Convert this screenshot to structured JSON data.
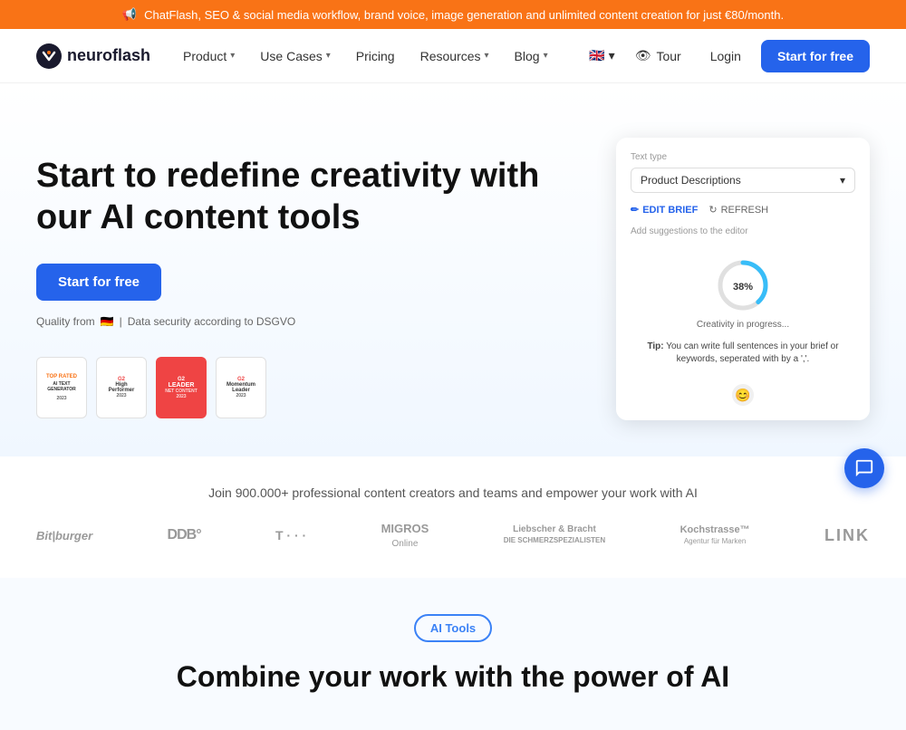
{
  "banner": {
    "icon": "📢",
    "text": "ChatFlash, SEO & social media workflow, brand voice, image generation and unlimited content creation for just €80/month."
  },
  "navbar": {
    "logo_text": "neuroflash",
    "nav_items": [
      {
        "label": "Product",
        "has_dropdown": true
      },
      {
        "label": "Use Cases",
        "has_dropdown": true
      },
      {
        "label": "Pricing",
        "has_dropdown": false
      },
      {
        "label": "Resources",
        "has_dropdown": true
      },
      {
        "label": "Blog",
        "has_dropdown": true
      }
    ],
    "flag": "🇬🇧",
    "tour_label": "Tour",
    "login_label": "Login",
    "start_label": "Start for free"
  },
  "hero": {
    "title": "Start to redefine creativity with our AI content tools",
    "cta_label": "Start for free",
    "quality_text": "Quality from",
    "quality_suffix": "Data security according to DSGVO",
    "flag": "🇩🇪",
    "badges": [
      {
        "line1": "TOP RATED",
        "line2": "AI TEXT\nGENERATOR",
        "year": "2023",
        "type": "capterra"
      },
      {
        "line1": "High\nPerformer",
        "year": "2023",
        "type": "g2-high"
      },
      {
        "line1": "LEADER",
        "line2": "NET\nCONTENT",
        "year": "2023",
        "type": "g2-leader"
      },
      {
        "line1": "Momentum\nLeader",
        "year": "2023",
        "type": "g2-momentum"
      }
    ]
  },
  "ui_preview": {
    "text_type_label": "Text type",
    "text_type_value": "Product Descriptions",
    "edit_brief_label": "EDIT BRIEF",
    "refresh_label": "REFRESH",
    "add_suggestions_label": "Add suggestions to the editor",
    "progress_percent": 38,
    "progress_label": "Creativity in progress...",
    "tip_label": "Tip:",
    "tip_text": "You can write full sentences in your brief or keywords, seperated with by a ','."
  },
  "partners": {
    "headline": "Join 900.000+ professional content creators and teams and empower your work with AI",
    "logos": [
      {
        "name": "Bit Burger",
        "display": "Bit|burger",
        "class": "bitburger"
      },
      {
        "name": "DDB",
        "display": "DDB°",
        "class": "ddb"
      },
      {
        "name": "Telekom",
        "display": "T · · ·",
        "class": "telekom"
      },
      {
        "name": "Migros Online",
        "display": "MIGROS\nOnline",
        "class": "migros"
      },
      {
        "name": "Liebscher & Bracht",
        "display": "Liebscher & Bracht\nDIE SCHMERZSPEZIALISTEN",
        "class": "liebscher"
      },
      {
        "name": "Kochstrasse",
        "display": "Kochstrasse™\nAgentur für Marken",
        "class": "kochstrasse"
      },
      {
        "name": "LINK",
        "display": "LINK",
        "class": "link"
      }
    ]
  },
  "bottom": {
    "ai_tools_badge": "AI Tools",
    "title": "Combine your work with the power of AI"
  }
}
